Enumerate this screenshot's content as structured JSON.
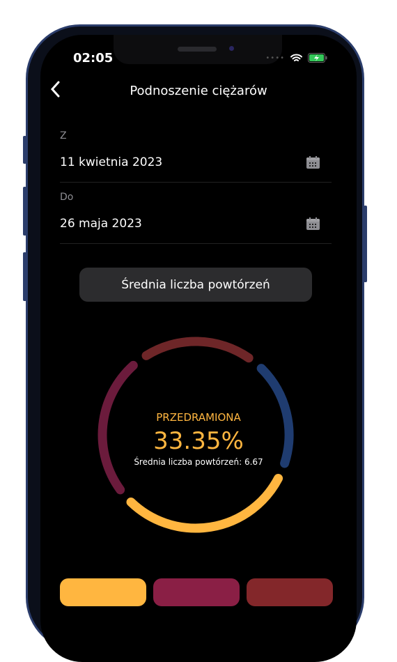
{
  "status_bar": {
    "time": "02:05",
    "wifi_icon": "wifi-icon",
    "battery_icon": "battery-charging-icon"
  },
  "header": {
    "title": "Podnoszenie ciężarów",
    "back_icon": "chevron-left-icon"
  },
  "form": {
    "from": {
      "label": "Z",
      "value": "11 kwietnia 2023",
      "icon": "calendar-icon"
    },
    "to": {
      "label": "Do",
      "value": "26 maja 2023",
      "icon": "calendar-icon"
    }
  },
  "metric_button": {
    "label": "Średnia liczba powtórzeń"
  },
  "chart_data": {
    "type": "pie",
    "style": "segmented-donut",
    "highlighted": {
      "label": "PRZEDRAMIONA",
      "percent": "33.35%",
      "subtitle": "Średnia liczba powtórzeń: 6.67"
    },
    "segments": [
      {
        "color": "#6e2628",
        "value": 22
      },
      {
        "color": "#1f3c70",
        "value": 21
      },
      {
        "color": "#ffb640",
        "value": 33.35
      },
      {
        "color": "#6b1b3c",
        "value": 27
      }
    ]
  },
  "bottom_buttons": [
    {
      "color": "#ffb640"
    },
    {
      "color": "#8a1f45"
    },
    {
      "color": "#83272a"
    }
  ]
}
